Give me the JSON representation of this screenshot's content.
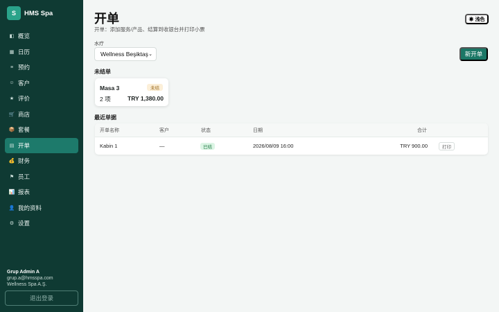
{
  "brand": {
    "logo_letter": "S",
    "name": "HMS Spa"
  },
  "sidebar": {
    "items": [
      {
        "icon": "overview-icon",
        "glyph": "◧",
        "label": "概览"
      },
      {
        "icon": "calendar-icon",
        "glyph": "▦",
        "label": "日历"
      },
      {
        "icon": "appointments-icon",
        "glyph": "≡",
        "label": "预约"
      },
      {
        "icon": "customers-icon",
        "glyph": "☺",
        "label": "客户"
      },
      {
        "icon": "star-icon",
        "glyph": "★",
        "label": "评价"
      },
      {
        "icon": "cart-icon",
        "glyph": "🛒",
        "label": "商店"
      },
      {
        "icon": "package-icon",
        "glyph": "📦",
        "label": "套餐"
      },
      {
        "icon": "receipt-icon",
        "glyph": "▤",
        "label": "开单",
        "active": true
      },
      {
        "icon": "money-bag-icon",
        "glyph": "💰",
        "label": "财务"
      },
      {
        "icon": "flag-icon",
        "glyph": "⚑",
        "label": "员工"
      },
      {
        "icon": "chart-icon",
        "glyph": "📊",
        "label": "报表"
      },
      {
        "icon": "profile-icon",
        "glyph": "👤",
        "label": "我的资料"
      },
      {
        "icon": "gear-icon",
        "glyph": "⚙",
        "label": "设置"
      }
    ],
    "user": {
      "name": "Grup Admin A",
      "email": "grup.a@hmsspa.com",
      "company": "Wellness Spa A.Ş."
    },
    "logout_label": "退出登录"
  },
  "header": {
    "title": "开单",
    "subtitle": "开单：添加服务/产品、结算到收银台并打印小票",
    "theme_label": "☀ 浅色"
  },
  "spa_select": {
    "label": "水疗",
    "value": "Wellness Beşiktaş"
  },
  "new_order_label": "新开单",
  "open_orders": {
    "heading": "未结单",
    "cards": [
      {
        "title": "Masa 3",
        "status": "未结",
        "count": "2 项",
        "total": "TRY 1,380.00"
      }
    ]
  },
  "recent": {
    "heading": "最近单据",
    "columns": [
      "开单名称",
      "客户",
      "状态",
      "日期",
      "合计"
    ],
    "rows": [
      {
        "name": "Kabin 1",
        "customer": "—",
        "status": "已结",
        "date": "2026/08/09 16:00",
        "total": "TRY 900.00",
        "action": "打印"
      }
    ]
  },
  "colors": {
    "sidebar_bg": "#0f3a33",
    "accent": "#1b7766",
    "active_nav": "#1d7a6b"
  }
}
